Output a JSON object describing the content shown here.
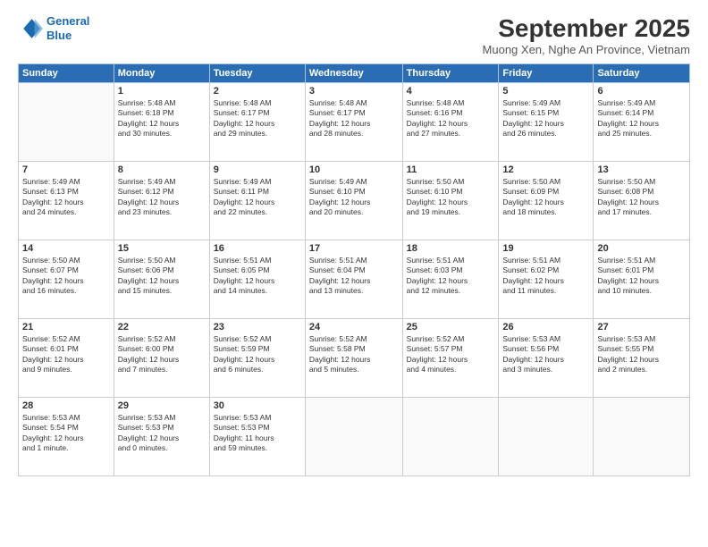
{
  "header": {
    "logo_line1": "General",
    "logo_line2": "Blue",
    "month": "September 2025",
    "location": "Muong Xen, Nghe An Province, Vietnam"
  },
  "weekdays": [
    "Sunday",
    "Monday",
    "Tuesday",
    "Wednesday",
    "Thursday",
    "Friday",
    "Saturday"
  ],
  "weeks": [
    [
      {
        "day": "",
        "info": ""
      },
      {
        "day": "1",
        "info": "Sunrise: 5:48 AM\nSunset: 6:18 PM\nDaylight: 12 hours\nand 30 minutes."
      },
      {
        "day": "2",
        "info": "Sunrise: 5:48 AM\nSunset: 6:17 PM\nDaylight: 12 hours\nand 29 minutes."
      },
      {
        "day": "3",
        "info": "Sunrise: 5:48 AM\nSunset: 6:17 PM\nDaylight: 12 hours\nand 28 minutes."
      },
      {
        "day": "4",
        "info": "Sunrise: 5:48 AM\nSunset: 6:16 PM\nDaylight: 12 hours\nand 27 minutes."
      },
      {
        "day": "5",
        "info": "Sunrise: 5:49 AM\nSunset: 6:15 PM\nDaylight: 12 hours\nand 26 minutes."
      },
      {
        "day": "6",
        "info": "Sunrise: 5:49 AM\nSunset: 6:14 PM\nDaylight: 12 hours\nand 25 minutes."
      }
    ],
    [
      {
        "day": "7",
        "info": "Sunrise: 5:49 AM\nSunset: 6:13 PM\nDaylight: 12 hours\nand 24 minutes."
      },
      {
        "day": "8",
        "info": "Sunrise: 5:49 AM\nSunset: 6:12 PM\nDaylight: 12 hours\nand 23 minutes."
      },
      {
        "day": "9",
        "info": "Sunrise: 5:49 AM\nSunset: 6:11 PM\nDaylight: 12 hours\nand 22 minutes."
      },
      {
        "day": "10",
        "info": "Sunrise: 5:49 AM\nSunset: 6:10 PM\nDaylight: 12 hours\nand 20 minutes."
      },
      {
        "day": "11",
        "info": "Sunrise: 5:50 AM\nSunset: 6:10 PM\nDaylight: 12 hours\nand 19 minutes."
      },
      {
        "day": "12",
        "info": "Sunrise: 5:50 AM\nSunset: 6:09 PM\nDaylight: 12 hours\nand 18 minutes."
      },
      {
        "day": "13",
        "info": "Sunrise: 5:50 AM\nSunset: 6:08 PM\nDaylight: 12 hours\nand 17 minutes."
      }
    ],
    [
      {
        "day": "14",
        "info": "Sunrise: 5:50 AM\nSunset: 6:07 PM\nDaylight: 12 hours\nand 16 minutes."
      },
      {
        "day": "15",
        "info": "Sunrise: 5:50 AM\nSunset: 6:06 PM\nDaylight: 12 hours\nand 15 minutes."
      },
      {
        "day": "16",
        "info": "Sunrise: 5:51 AM\nSunset: 6:05 PM\nDaylight: 12 hours\nand 14 minutes."
      },
      {
        "day": "17",
        "info": "Sunrise: 5:51 AM\nSunset: 6:04 PM\nDaylight: 12 hours\nand 13 minutes."
      },
      {
        "day": "18",
        "info": "Sunrise: 5:51 AM\nSunset: 6:03 PM\nDaylight: 12 hours\nand 12 minutes."
      },
      {
        "day": "19",
        "info": "Sunrise: 5:51 AM\nSunset: 6:02 PM\nDaylight: 12 hours\nand 11 minutes."
      },
      {
        "day": "20",
        "info": "Sunrise: 5:51 AM\nSunset: 6:01 PM\nDaylight: 12 hours\nand 10 minutes."
      }
    ],
    [
      {
        "day": "21",
        "info": "Sunrise: 5:52 AM\nSunset: 6:01 PM\nDaylight: 12 hours\nand 9 minutes."
      },
      {
        "day": "22",
        "info": "Sunrise: 5:52 AM\nSunset: 6:00 PM\nDaylight: 12 hours\nand 7 minutes."
      },
      {
        "day": "23",
        "info": "Sunrise: 5:52 AM\nSunset: 5:59 PM\nDaylight: 12 hours\nand 6 minutes."
      },
      {
        "day": "24",
        "info": "Sunrise: 5:52 AM\nSunset: 5:58 PM\nDaylight: 12 hours\nand 5 minutes."
      },
      {
        "day": "25",
        "info": "Sunrise: 5:52 AM\nSunset: 5:57 PM\nDaylight: 12 hours\nand 4 minutes."
      },
      {
        "day": "26",
        "info": "Sunrise: 5:53 AM\nSunset: 5:56 PM\nDaylight: 12 hours\nand 3 minutes."
      },
      {
        "day": "27",
        "info": "Sunrise: 5:53 AM\nSunset: 5:55 PM\nDaylight: 12 hours\nand 2 minutes."
      }
    ],
    [
      {
        "day": "28",
        "info": "Sunrise: 5:53 AM\nSunset: 5:54 PM\nDaylight: 12 hours\nand 1 minute."
      },
      {
        "day": "29",
        "info": "Sunrise: 5:53 AM\nSunset: 5:53 PM\nDaylight: 12 hours\nand 0 minutes."
      },
      {
        "day": "30",
        "info": "Sunrise: 5:53 AM\nSunset: 5:53 PM\nDaylight: 11 hours\nand 59 minutes."
      },
      {
        "day": "",
        "info": ""
      },
      {
        "day": "",
        "info": ""
      },
      {
        "day": "",
        "info": ""
      },
      {
        "day": "",
        "info": ""
      }
    ]
  ]
}
